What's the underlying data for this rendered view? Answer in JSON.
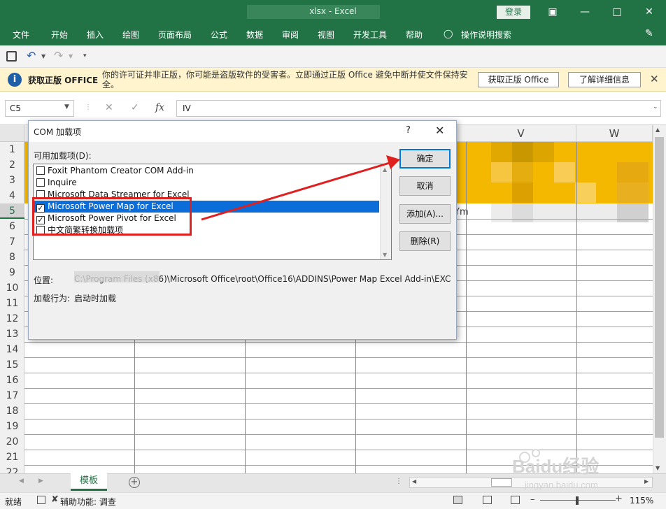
{
  "titlebar": {
    "title": "xlsx - Excel",
    "login": "登录"
  },
  "ribbon": {
    "tabs": [
      "文件",
      "开始",
      "插入",
      "绘图",
      "页面布局",
      "公式",
      "数据",
      "审阅",
      "视图",
      "开发工具",
      "帮助"
    ],
    "tellme": "操作说明搜索"
  },
  "warning": {
    "title": "获取正版 OFFICE",
    "message": "你的许可证并非正版，你可能是盗版软件的受害者。立即通过正版 Office 避免中断并使文件保持安全。",
    "btn_genuine": "获取正版 Office",
    "btn_learn": "了解详细信息"
  },
  "formula_bar": {
    "name_box": "C5",
    "fx": "fx",
    "value": "IV"
  },
  "grid": {
    "columns": [
      "V",
      "W"
    ],
    "rows": [
      "1",
      "2",
      "3",
      "4",
      "5",
      "6",
      "7",
      "8",
      "9",
      "10",
      "11",
      "12",
      "13",
      "14",
      "15",
      "16",
      "17",
      "18",
      "19",
      "20",
      "21",
      "22"
    ],
    "selected_row": "5",
    "peek_cell": "Ym"
  },
  "dialog": {
    "title": "COM 加载项",
    "help": "?",
    "list_label": "可用加载项(D):",
    "items": [
      {
        "label": "Foxit Phantom Creator COM Add-in",
        "checked": false
      },
      {
        "label": "Inquire",
        "checked": false
      },
      {
        "label": "Microsoft Data Streamer for Excel",
        "checked": false
      },
      {
        "label": "Microsoft Power Map for Excel",
        "checked": true
      },
      {
        "label": "Microsoft Power Pivot for Excel",
        "checked": true
      },
      {
        "label": "中文简繁转换加载项",
        "checked": false
      }
    ],
    "buttons": {
      "ok": "确定",
      "cancel": "取消",
      "add": "添加(A)...",
      "remove": "删除(R)"
    },
    "location_label": "位置:",
    "location_value": "C:\\Program Files (x86)\\Microsoft Office\\root\\Office16\\ADDINS\\Power Map Excel Add-in\\EXC",
    "behavior_label": "加载行为:",
    "behavior_value": "启动时加载"
  },
  "sheet_tabs": {
    "active": "模板",
    "add": "+"
  },
  "status": {
    "ready": "就绪",
    "accessibility": "辅助功能: 调查",
    "zoom": "115%"
  },
  "watermark": {
    "brand": "Baidu经验",
    "url": "jingyan.baidu.com"
  },
  "colors": {
    "excel_green": "#217346",
    "warning_bg": "#fff4ce",
    "selection_blue": "#0a6dd9",
    "highlight_yellow": "#f5b800",
    "annotation_red": "#e01f1f"
  }
}
